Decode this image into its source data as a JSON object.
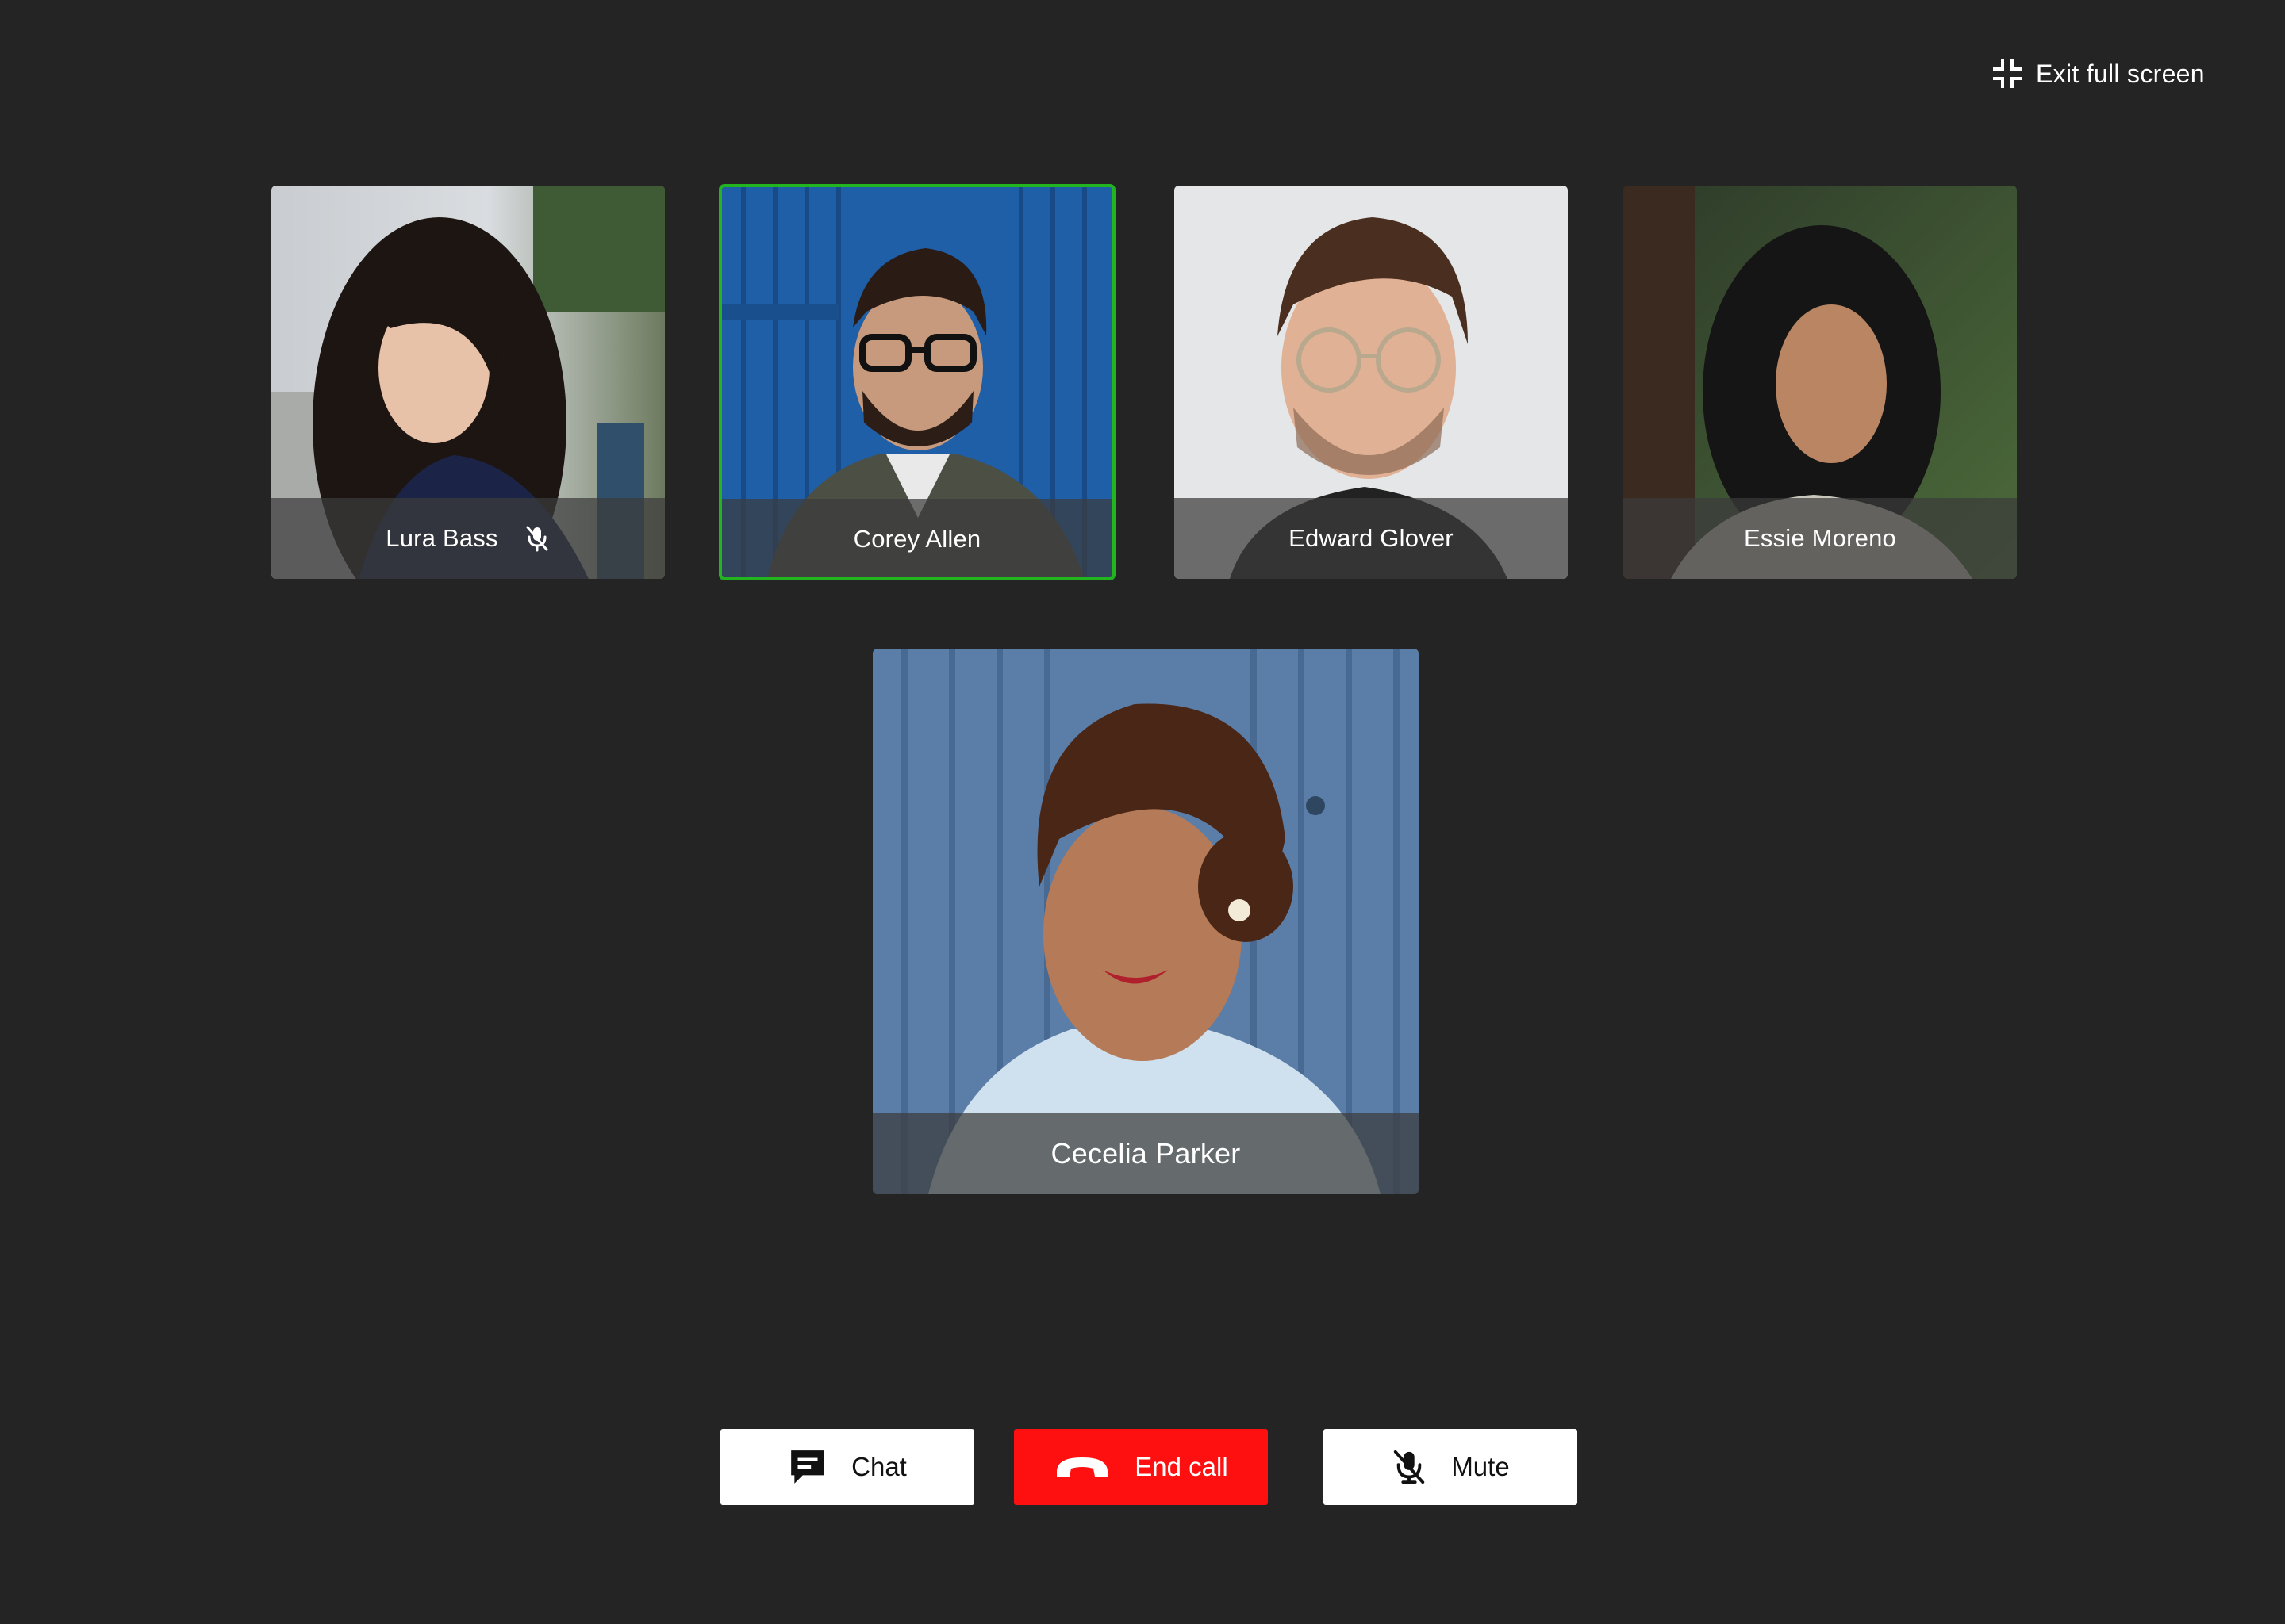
{
  "header": {
    "exit_fullscreen_label": "Exit full screen",
    "exit_fullscreen_icon": "exit-fullscreen-icon"
  },
  "participants": [
    {
      "name": "Lura Bass",
      "muted": true,
      "active": false
    },
    {
      "name": "Corey Allen",
      "muted": false,
      "active": true
    },
    {
      "name": "Edward Glover",
      "muted": false,
      "active": false
    },
    {
      "name": "Essie Moreno",
      "muted": false,
      "active": false
    }
  ],
  "spotlight": {
    "name": "Cecelia Parker"
  },
  "controls": {
    "chat_label": "Chat",
    "chat_icon": "chat-icon",
    "end_call_label": "End call",
    "end_call_icon": "hang-up-icon",
    "mute_label": "Mute",
    "mute_icon": "mic-off-icon"
  },
  "colors": {
    "background": "#242424",
    "active_speaker_border": "#22b51f",
    "end_call": "#ff1010",
    "button_white": "#ffffff"
  }
}
